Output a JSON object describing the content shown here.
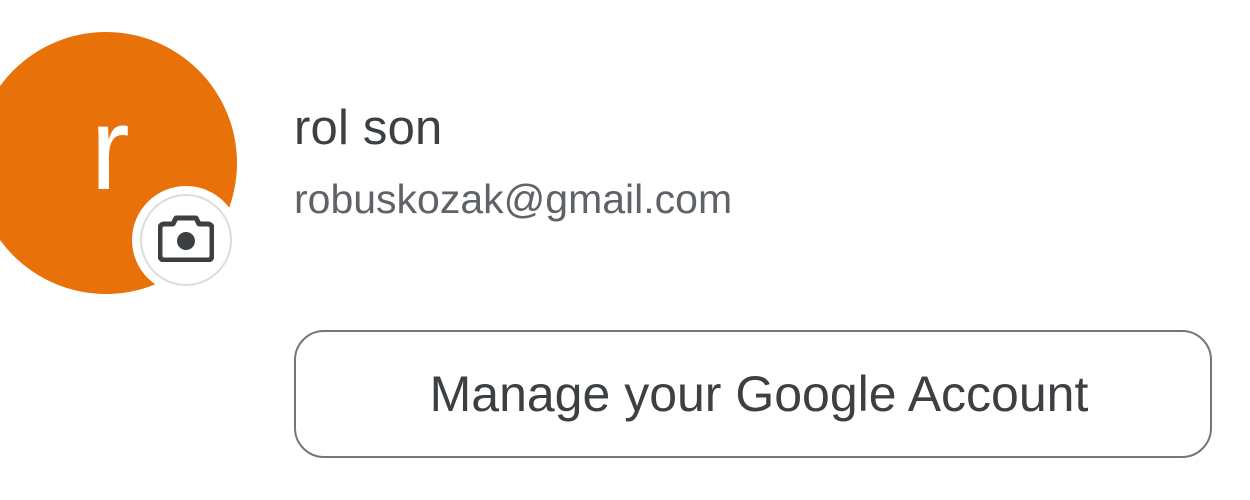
{
  "account": {
    "avatar_letter": "r",
    "avatar_color": "#e8710a",
    "name": "rol son",
    "email": "robuskozak@gmail.com",
    "change_photo_icon": "camera-icon",
    "manage_button_label": "Manage your Google Account"
  },
  "colors": {
    "text_primary": "#3c4043",
    "text_secondary": "#5f6368",
    "button_border": "#747775"
  }
}
